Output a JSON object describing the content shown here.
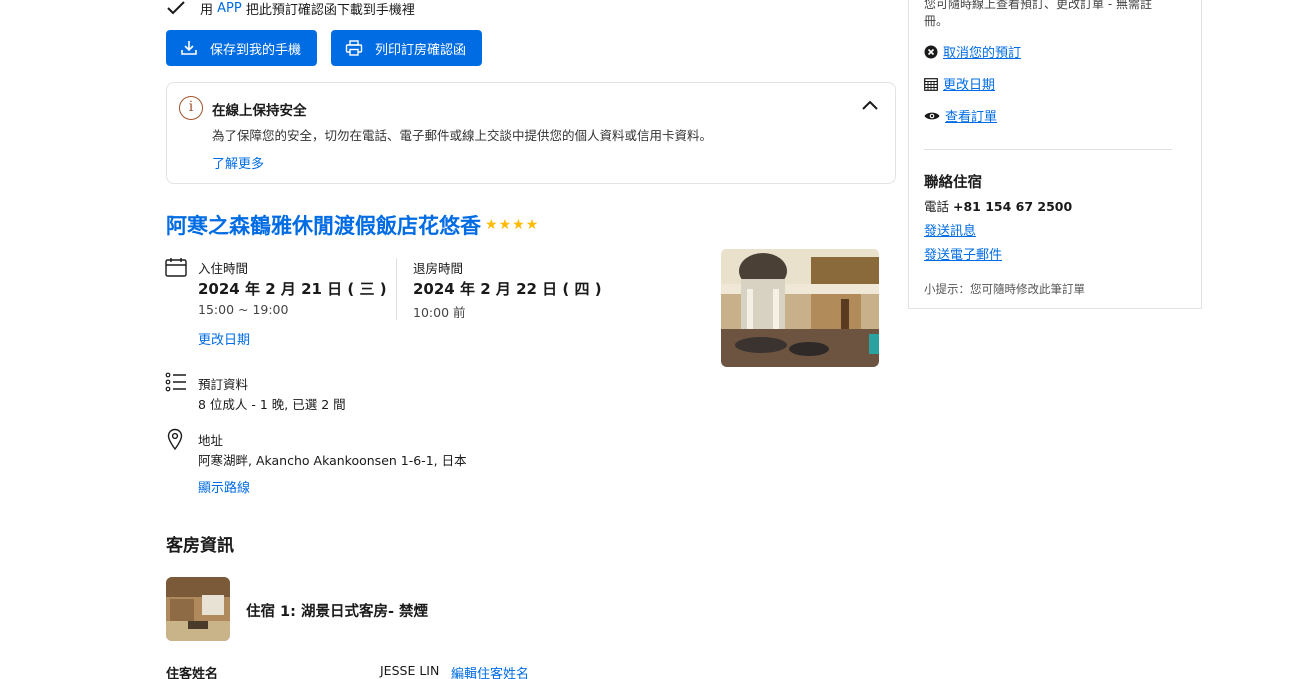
{
  "app_line": {
    "prefix": "用",
    "app": "APP",
    "rest": "把此預訂確認函下載到手機裡"
  },
  "buttons": {
    "save": "保存到我的手機",
    "print": "列印訂房確認函"
  },
  "safety": {
    "title": "在線上保持安全",
    "desc": "為了保障您的安全，切勿在電話、電子郵件或線上交談中提供您的個人資料或信用卡資料。",
    "more": "了解更多",
    "info_glyph": "i"
  },
  "hotel": {
    "name": "阿寒之森鶴雅休閒渡假飯店花悠香",
    "stars": 4,
    "star_glyph": "★"
  },
  "checkin": {
    "label": "入住時間",
    "date": "2024 年 2 月 21 日 ( 三 )",
    "time": "15:00 ~ 19:00",
    "change": "更改日期"
  },
  "checkout": {
    "label": "退房時間",
    "date": "2024 年 2 月 22 日 ( 四 )",
    "time": "10:00 前"
  },
  "booking": {
    "label": "預訂資料",
    "value": "8 位成人 - 1 晚, 已選 2 間"
  },
  "address": {
    "label": "地址",
    "value": "阿寒湖畔, Akancho Akankoonsen 1-6-1, 日本",
    "directions": "顯示路線"
  },
  "rooms": {
    "section_title": "客房資訊",
    "room1": "住宿 1: 湖景日式客房- 禁煙"
  },
  "guest": {
    "label": "住客姓名",
    "name": "JESSE LIN",
    "edit": "編輯住客姓名"
  },
  "sidebar": {
    "top_text": "您可隨時線上查看預訂、更改訂單 - 無需註冊。",
    "cancel": "取消您的預訂",
    "change_dates": "更改日期",
    "view": "查看訂單",
    "contact_title": "聯絡住宿",
    "phone_label": "電話",
    "phone": "+81 154 67 2500",
    "message": "發送訊息",
    "email": "發送電子郵件",
    "tip": "小提示：您可隨時修改此筆訂單"
  },
  "colors": {
    "accent": "#006ce4",
    "star": "#febb02",
    "info": "#a0522d"
  }
}
